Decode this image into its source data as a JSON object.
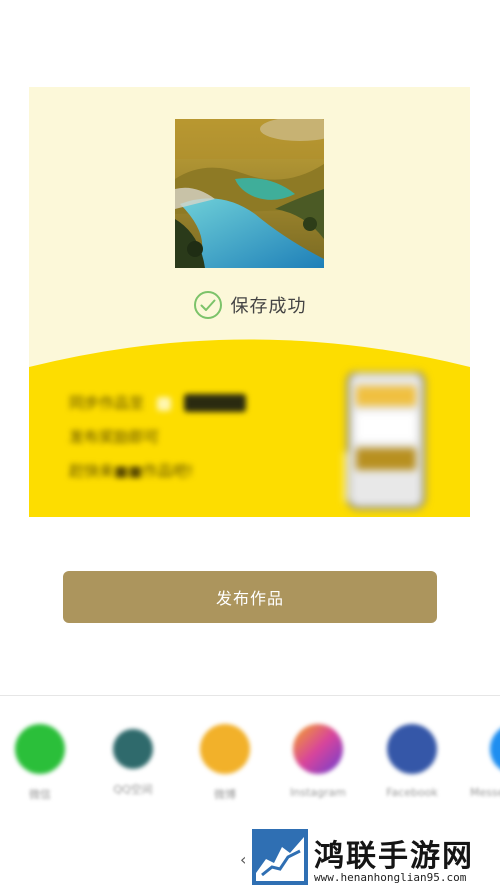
{
  "card": {
    "success_text": "保存成功",
    "promo": {
      "line1_prefix": "同步作品至",
      "line1_highlight": "■■■■",
      "line2": "发布奖励即可",
      "line3": "赶快来■■作品吧!"
    }
  },
  "publish_button": {
    "label": "发布作品"
  },
  "share": {
    "items": [
      {
        "label": "微信",
        "icon": "wechat-icon",
        "color": "#2bbf3a"
      },
      {
        "label": "QQ空间",
        "icon": "qzone-icon",
        "color": "#2f6a6c"
      },
      {
        "label": "微博",
        "icon": "weibo-icon",
        "color": "#f2b12a"
      },
      {
        "label": "Instagram",
        "icon": "instagram-icon",
        "color": "#d8449c"
      },
      {
        "label": "Facebook",
        "icon": "facebook-icon",
        "color": "#3557a8"
      },
      {
        "label": "Messenger",
        "icon": "messenger-icon",
        "color": "#1e8ef0"
      }
    ]
  },
  "watermark": {
    "title": "鸿联手游网",
    "url": "www.henanhonglian95.com"
  },
  "colors": {
    "card_bg": "#fcf8d9",
    "promo_yellow": "#fddd00",
    "button": "#ac955d",
    "check": "#7cc36a"
  }
}
